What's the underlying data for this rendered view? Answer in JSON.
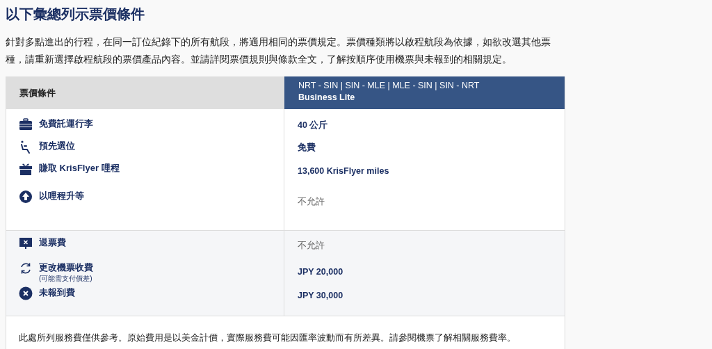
{
  "heading": "以下彙總列示票價條件",
  "intro": "針對多點進出的行程，在同一訂位紀錄下的所有航段，將適用相同的票價規定。票價種類將以啟程航段為依據，如欲改選其他票種，請重新選擇啟程航段的票價產品內容。並請詳閱票價規則與條款全文，了解按順序使用機票與未報到的相關規定。",
  "table": {
    "column_1": "票價條件",
    "route": "NRT - SIN | SIN - MLE | MLE - SIN | SIN - NRT",
    "fare": "Business Lite",
    "sections": [
      {
        "rows": [
          {
            "kind": "baggage",
            "label": "免費託運行李",
            "value": "40 公斤",
            "emphasis": true
          },
          {
            "kind": "seat",
            "label": "預先選位",
            "value": "免費",
            "emphasis": true
          },
          {
            "kind": "gift",
            "label": "賺取 KrisFlyer 哩程",
            "value": "13,600 KrisFlyer miles",
            "emphasis": true
          },
          {
            "kind": "upgrade",
            "label": "以哩程升等",
            "value": "不允許",
            "emphasis": false
          }
        ]
      },
      {
        "rows": [
          {
            "kind": "refund",
            "label": "退票費",
            "value": "不允許",
            "emphasis": false
          },
          {
            "kind": "change",
            "label": "更改機票收費",
            "sublabel": "(可能需支付價差)",
            "value": "JPY 20,000",
            "emphasis": true
          },
          {
            "kind": "noshow",
            "label": "未報到費",
            "value": "JPY 30,000",
            "emphasis": true
          }
        ]
      }
    ],
    "footnote": "此處所列服務費僅供參考。原始費用是以美金計價，實際服務費可能因匯率波動而有所差異。請參閱機票了解相關服務費率。"
  }
}
